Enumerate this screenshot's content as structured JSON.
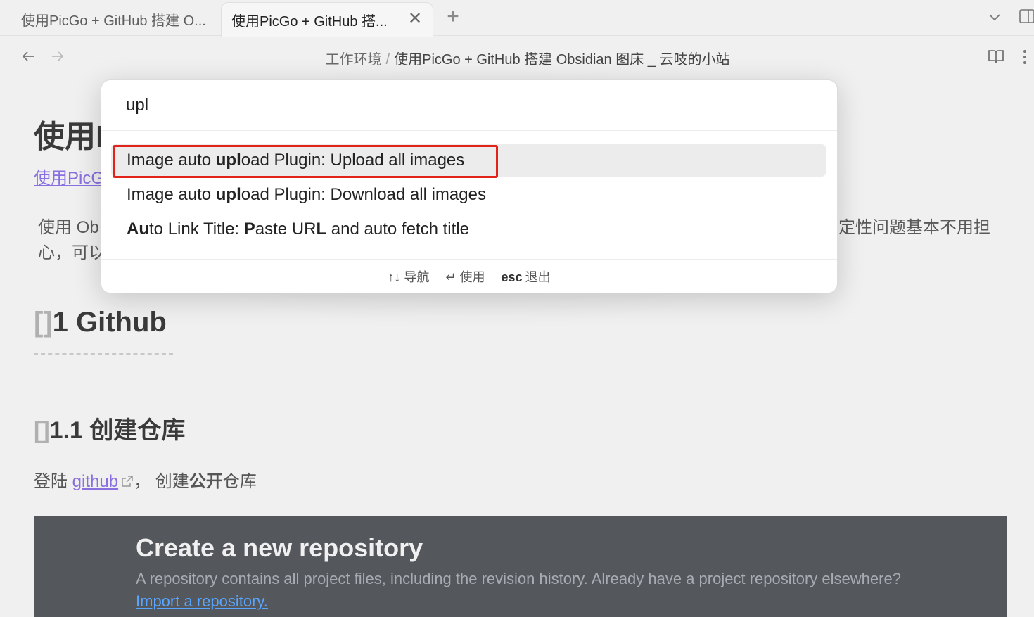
{
  "tabs": [
    {
      "label": "使用PicGo + GitHub 搭建 O..."
    },
    {
      "label": "使用PicGo + GitHub 搭..."
    }
  ],
  "tab_close_glyph": "✕",
  "new_tab_glyph": "+",
  "breadcrumb": {
    "folder": "工作环境",
    "separator": "/",
    "current": "使用PicGo + GitHub 搭建 Obsidian 图床 _ 云吱的小站"
  },
  "document": {
    "title_partial": "使用I",
    "link_partial": "使用PicG",
    "para_left": "使用 Ob\n心，可以",
    "para_right": "定性问题基本不用担",
    "h1_bracket": "[]",
    "h1_text": "1 Github",
    "h2_bracket": "[]",
    "h2_text": "1.1 创建仓库",
    "body_prefix": "登陆 ",
    "body_link": "github",
    "body_mid": "， 创建",
    "body_bold": "公开",
    "body_suffix": "仓库"
  },
  "embed": {
    "title": "Create a new repository",
    "description": "A repository contains all project files, including the revision history. Already have a project repository elsewhere?",
    "link": "Import a repository."
  },
  "palette": {
    "query": "upl",
    "suggestions": [
      {
        "pre": "Image auto ",
        "bold": "upl",
        "post": "oad Plugin: Upload all images"
      },
      {
        "pre": "Image auto ",
        "bold": "upl",
        "post": "oad Plugin: Download all images"
      }
    ],
    "suggestion3": {
      "a": "A",
      "b": "u",
      "c": "to Link Title: ",
      "d": "P",
      "e": "aste UR",
      "f": "L",
      "g": " and auto fetch title"
    },
    "footer": {
      "nav_key": "↑↓",
      "nav_label": "导航",
      "use_key": "↵",
      "use_label": "使用",
      "esc_key": "esc",
      "esc_label": "退出"
    }
  },
  "accent_colors": {
    "link": "#8a6fe0",
    "highlight_box": "#e2231a"
  }
}
